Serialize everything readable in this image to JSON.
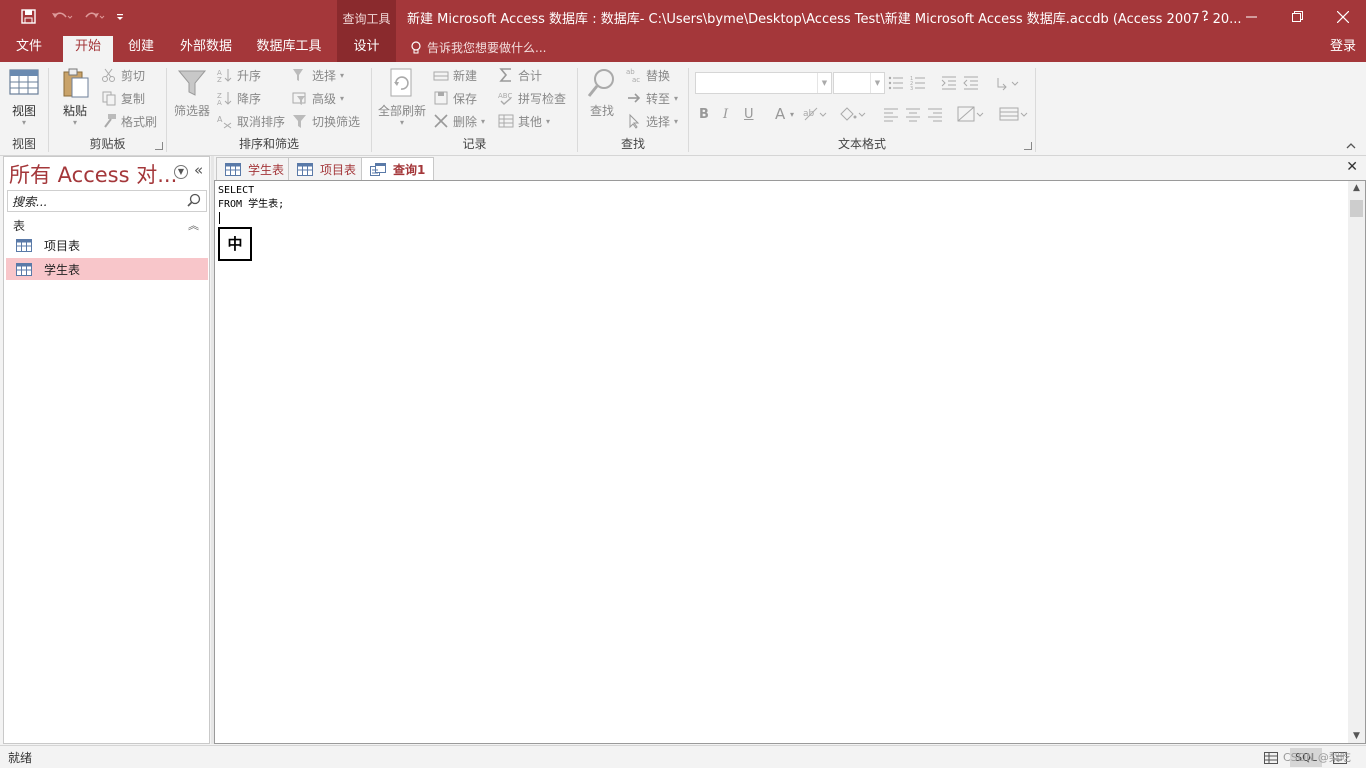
{
  "titlebar": {
    "context_tool": "查询工具",
    "title": "新建 Microsoft Access 数据库 : 数据库- C:\\Users\\byme\\Desktop\\Access Test\\新建 Microsoft Access 数据库.accdb (Access 2007 - 20...",
    "help": "?",
    "accent_color": "#a4373a"
  },
  "ribbon_tabs": {
    "file": "文件",
    "home": "开始",
    "create": "创建",
    "external": "外部数据",
    "dbtools": "数据库工具",
    "design": "设计",
    "tellme": "告诉我您想要做什么...",
    "signin": "登录"
  },
  "ribbon": {
    "views": {
      "view": "视图",
      "label": "视图"
    },
    "clipboard": {
      "paste": "粘贴",
      "cut": "剪切",
      "copy": "复制",
      "format_painter": "格式刷",
      "label": "剪贴板"
    },
    "sort_filter": {
      "filter": "筛选器",
      "ascending": "升序",
      "descending": "降序",
      "remove_sort": "取消排序",
      "selection": "选择",
      "advanced": "高级",
      "toggle_filter": "切换筛选",
      "label": "排序和筛选"
    },
    "records": {
      "refresh_all": "全部刷新",
      "new": "新建",
      "save": "保存",
      "delete": "删除",
      "totals": "合计",
      "spelling": "拼写检查",
      "more": "其他",
      "label": "记录"
    },
    "find": {
      "find": "查找",
      "replace": "替换",
      "goto": "转至",
      "select": "选择",
      "label": "查找"
    },
    "text_format": {
      "bold": "B",
      "italic": "I",
      "underline": "U",
      "font_color": "A",
      "label": "文本格式"
    }
  },
  "nav": {
    "title": "所有 Access 对...",
    "search_placeholder": "搜索...",
    "group": "表",
    "items": [
      {
        "label": "项目表",
        "selected": false
      },
      {
        "label": "学生表",
        "selected": true
      }
    ]
  },
  "doc_tabs": [
    {
      "label": "学生表",
      "active": false
    },
    {
      "label": "项目表",
      "active": false
    },
    {
      "label": "查询1",
      "active": true
    }
  ],
  "editor": {
    "sql": "SELECT\nFROM 学生表;",
    "ime_indicator": "中"
  },
  "statusbar": {
    "text": "就绪",
    "sql_view": "SQL",
    "watermark": "CSDN @梨吃"
  }
}
